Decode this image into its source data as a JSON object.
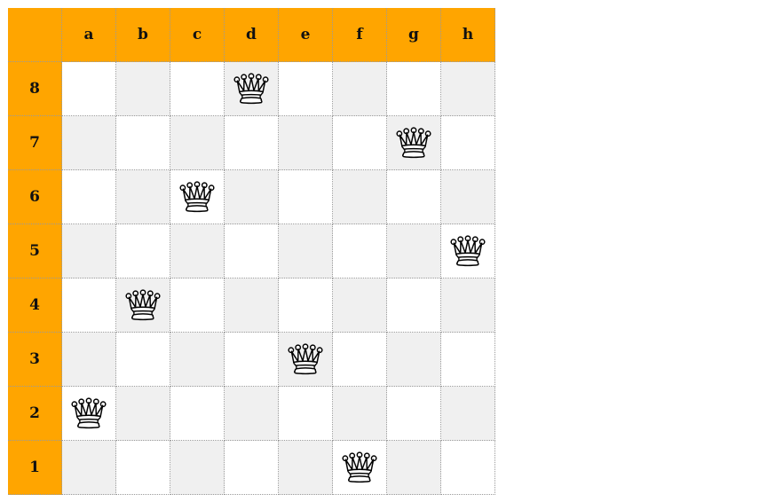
{
  "board": {
    "files": [
      "a",
      "b",
      "c",
      "d",
      "e",
      "f",
      "g",
      "h"
    ],
    "ranks": [
      "8",
      "7",
      "6",
      "5",
      "4",
      "3",
      "2",
      "1"
    ],
    "colors": {
      "header": "#FFA500",
      "light_square": "#FFFFFF",
      "dark_square": "#F0F0F0",
      "grid_line": "#9A9A9A"
    },
    "piece_icon": "white-queen-icon",
    "queens": [
      {
        "square": "d8",
        "color": "white"
      },
      {
        "square": "g7",
        "color": "white"
      },
      {
        "square": "c6",
        "color": "white"
      },
      {
        "square": "h5",
        "color": "white"
      },
      {
        "square": "b4",
        "color": "white"
      },
      {
        "square": "e3",
        "color": "white"
      },
      {
        "square": "a2",
        "color": "white"
      },
      {
        "square": "f1",
        "color": "white"
      }
    ]
  }
}
